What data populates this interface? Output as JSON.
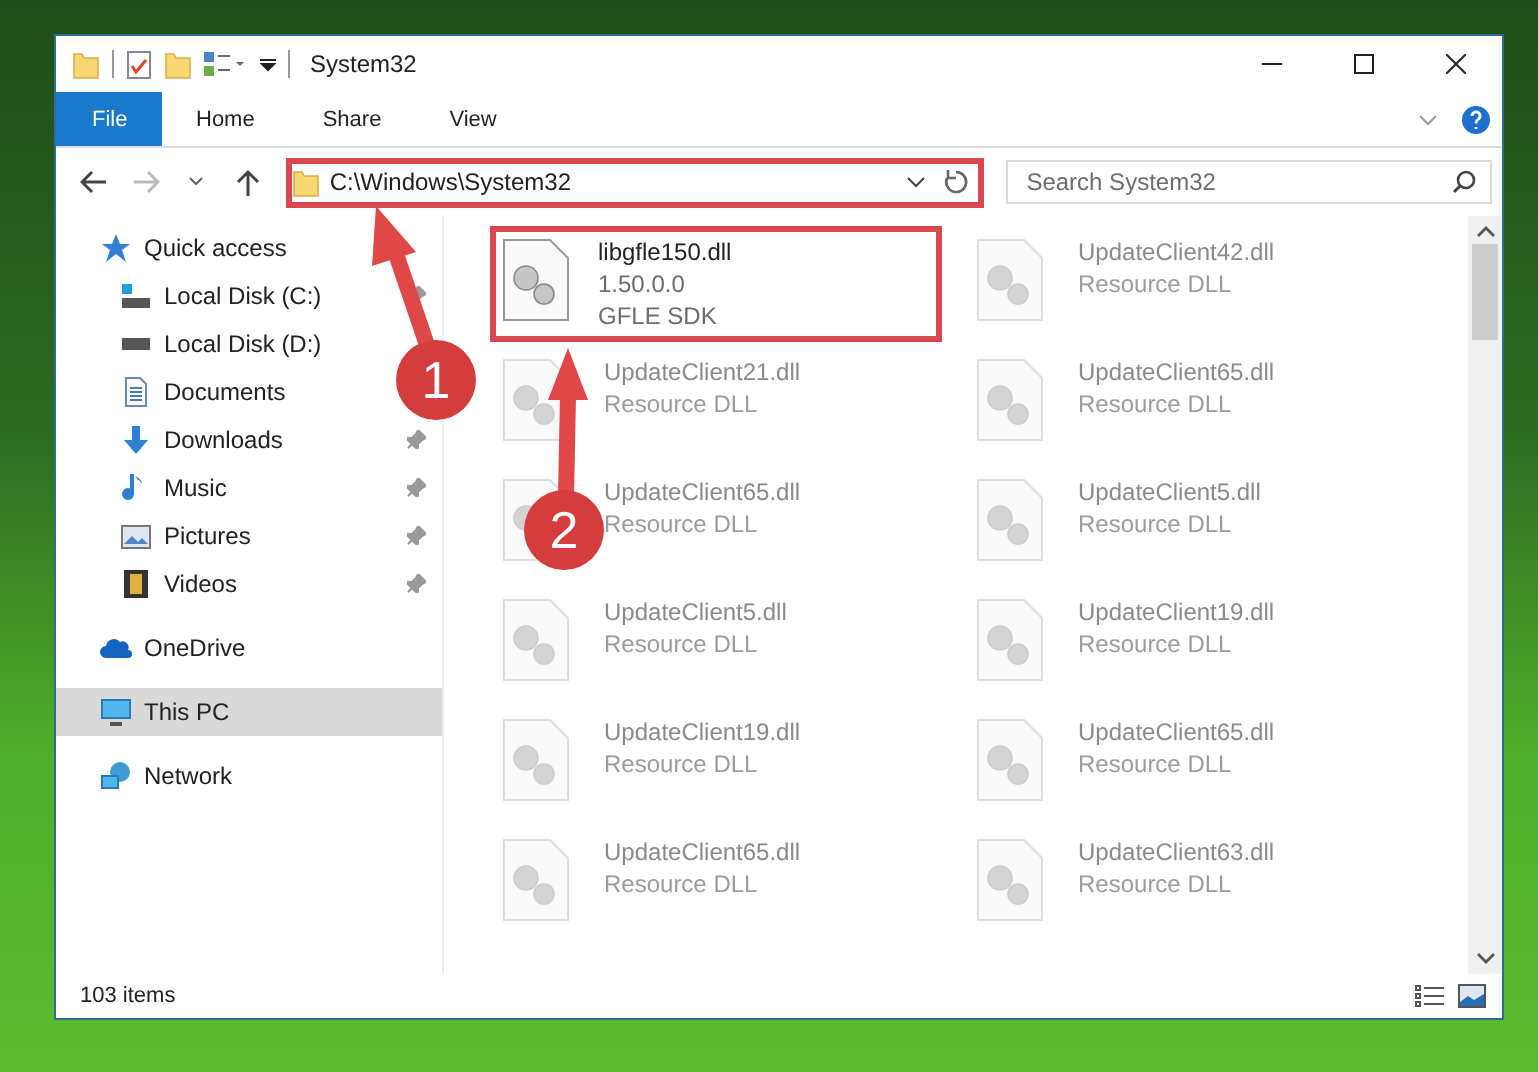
{
  "window": {
    "title": "System32"
  },
  "ribbon_tabs": [
    {
      "label": "File",
      "kind": "file"
    },
    {
      "label": "Home",
      "kind": "tab"
    },
    {
      "label": "Share",
      "kind": "tab"
    },
    {
      "label": "View",
      "kind": "tab"
    }
  ],
  "address": {
    "path": "C:\\Windows\\System32",
    "highlighted": true
  },
  "search": {
    "placeholder": "Search System32"
  },
  "navigation": [
    {
      "label": "Quick access",
      "kind": "star",
      "selected": false,
      "pinned": false,
      "children": [
        {
          "label": "Local Disk (C:)",
          "kind": "system-drive",
          "selected": false,
          "pinned": true
        },
        {
          "label": "Local Disk (D:)",
          "kind": "drive",
          "selected": false,
          "pinned": false
        },
        {
          "label": "Documents",
          "kind": "documents",
          "selected": false,
          "pinned": false
        },
        {
          "label": "Downloads",
          "kind": "downloads",
          "selected": false,
          "pinned": true
        },
        {
          "label": "Music",
          "kind": "music",
          "selected": false,
          "pinned": true
        },
        {
          "label": "Pictures",
          "kind": "pictures",
          "selected": false,
          "pinned": true
        },
        {
          "label": "Videos",
          "kind": "videos",
          "selected": false,
          "pinned": true
        }
      ]
    },
    {
      "label": "OneDrive",
      "kind": "cloud",
      "selected": false,
      "pinned": false
    },
    {
      "label": "This PC",
      "kind": "computer",
      "selected": true,
      "pinned": false
    },
    {
      "label": "Network",
      "kind": "network",
      "selected": false,
      "pinned": false
    }
  ],
  "files": [
    {
      "name": "libgfle150.dll",
      "details": [
        "1.50.0.0",
        "GFLE SDK"
      ],
      "highlighted": true,
      "blurred": false
    },
    {
      "name": "UpdateClient42.dll",
      "details": [
        "Resource DLL"
      ],
      "highlighted": false,
      "blurred": true
    },
    {
      "name": "UpdateClient21.dll",
      "details": [
        "Resource DLL"
      ],
      "highlighted": false,
      "blurred": true
    },
    {
      "name": "UpdateClient65.dll",
      "details": [
        "Resource DLL"
      ],
      "highlighted": false,
      "blurred": true
    },
    {
      "name": "UpdateClient65.dll",
      "details": [
        "Resource DLL"
      ],
      "highlighted": false,
      "blurred": true
    },
    {
      "name": "UpdateClient5.dll",
      "details": [
        "Resource DLL"
      ],
      "highlighted": false,
      "blurred": true
    },
    {
      "name": "UpdateClient5.dll",
      "details": [
        "Resource DLL"
      ],
      "highlighted": false,
      "blurred": true
    },
    {
      "name": "UpdateClient19.dll",
      "details": [
        "Resource DLL"
      ],
      "highlighted": false,
      "blurred": true
    },
    {
      "name": "UpdateClient19.dll",
      "details": [
        "Resource DLL"
      ],
      "highlighted": false,
      "blurred": true
    },
    {
      "name": "UpdateClient65.dll",
      "details": [
        "Resource DLL"
      ],
      "highlighted": false,
      "blurred": true
    },
    {
      "name": "UpdateClient65.dll",
      "details": [
        "Resource DLL"
      ],
      "highlighted": false,
      "blurred": true
    },
    {
      "name": "UpdateClient63.dll",
      "details": [
        "Resource DLL"
      ],
      "highlighted": false,
      "blurred": true
    }
  ],
  "status_bar": {
    "item_count": "103 items"
  },
  "annotations": [
    {
      "label": "1"
    },
    {
      "label": "2"
    }
  ]
}
